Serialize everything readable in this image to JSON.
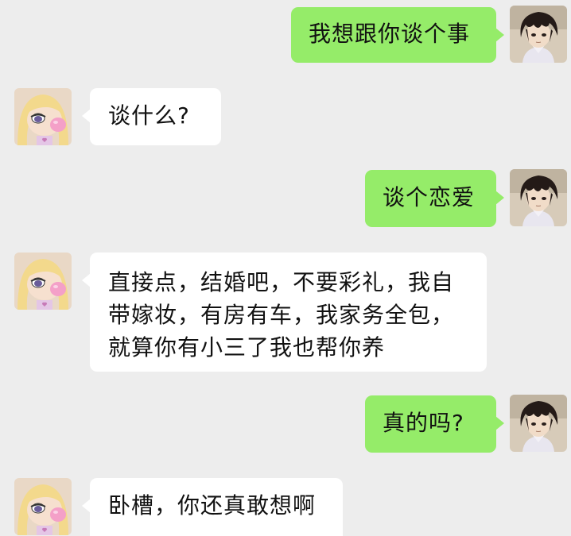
{
  "conversation": {
    "messages": [
      {
        "sender": "me",
        "text": "我想跟你谈个事"
      },
      {
        "sender": "her",
        "text": "谈什么?"
      },
      {
        "sender": "me",
        "text": "谈个恋爱"
      },
      {
        "sender": "her",
        "text": "直接点，结婚吧，不要彩礼，我自带嫁妆，有房有车，我家务全包，就算你有小三了我也帮你养"
      },
      {
        "sender": "me",
        "text": "真的吗?"
      },
      {
        "sender": "her",
        "text": "卧槽，你还真敢想啊"
      }
    ]
  },
  "theme": {
    "background": "#ededed",
    "outgoing_bubble": "#95ec69",
    "incoming_bubble": "#ffffff"
  },
  "icons": {
    "me_avatar": "anime-boy-avatar-icon",
    "her_avatar": "cartoon-girl-bubblegum-avatar-icon"
  }
}
